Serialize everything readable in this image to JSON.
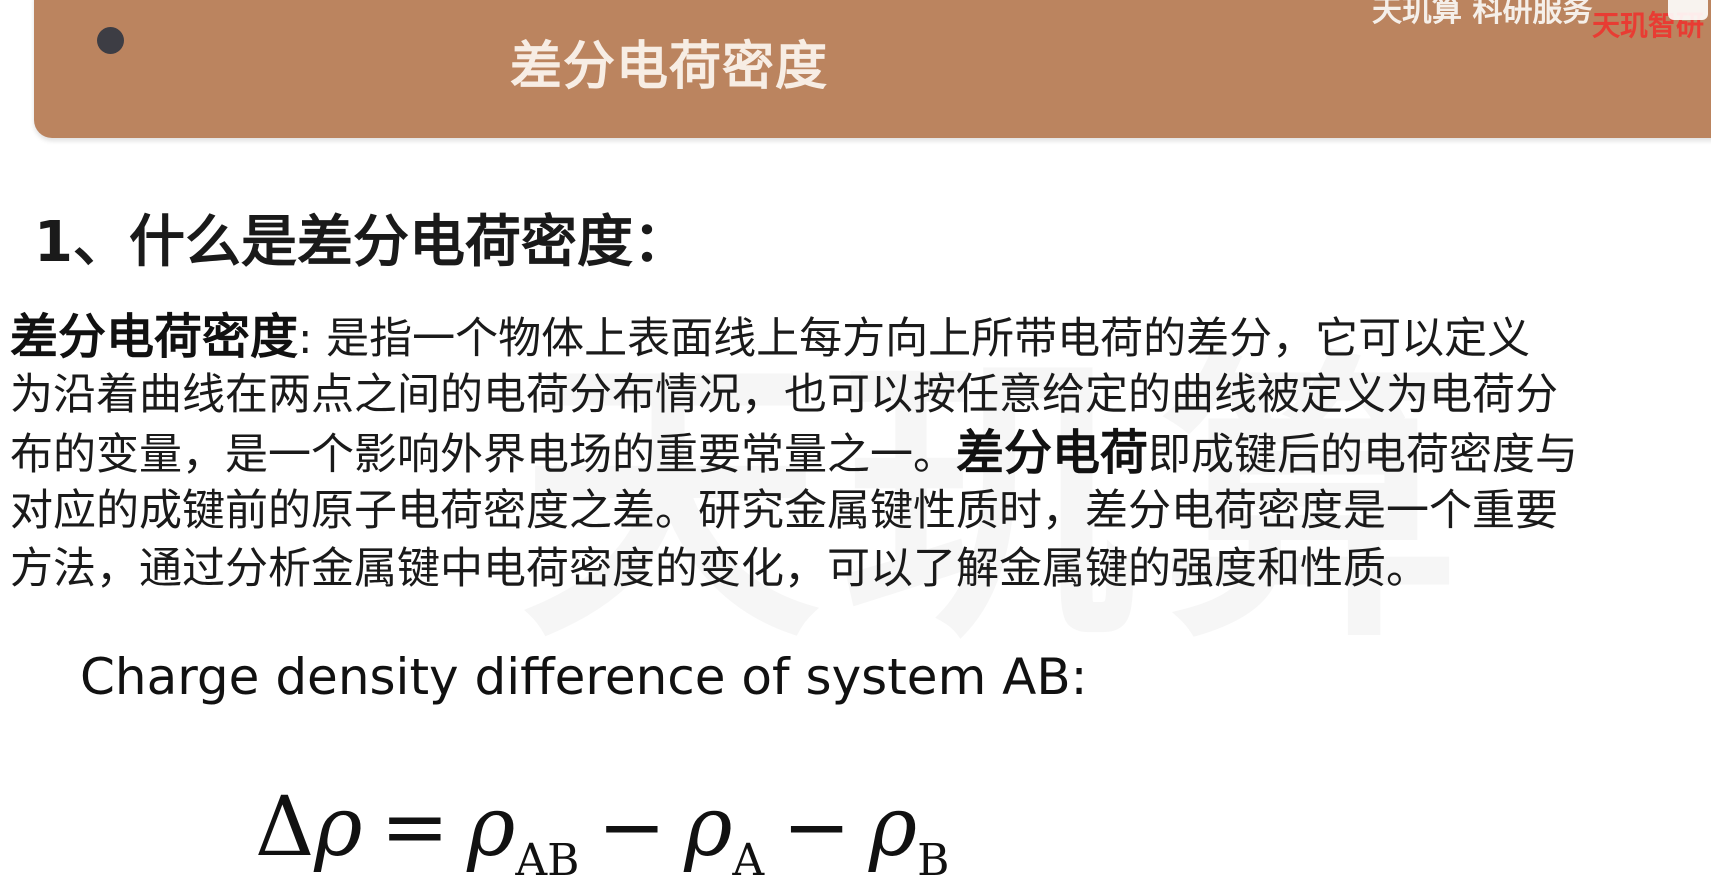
{
  "header": {
    "title": "差分电荷密度",
    "watermark_top": "天玑算 科研服务",
    "watermark_red": "天玑智研",
    "watermark_center": "天玑算"
  },
  "section": {
    "heading": "1、什么是差分电荷密度："
  },
  "paragraph": {
    "term1": "差分电荷密度",
    "line1_rest": ": 是指一个物体上表面线上每方向上所带电荷的差分，它可以定义",
    "line2": "为沿着曲线在两点之间的电荷分布情况，也可以按任意给定的曲线被定义为电荷分",
    "line3_start": "布的变量，是一个影响外界电场的重要常量之一。",
    "term2": "差分电荷",
    "line3_end": "即成键后的电荷密度与",
    "line4": "对应的成键前的原子电荷密度之差。研究金属键性质时，差分电荷密度是一个重要",
    "line5": "方法，通过分析金属键中电荷密度的变化，可以了解金属键的强度和性质。"
  },
  "subtitle": "Charge density difference of system AB:",
  "formula": {
    "delta": "Δ",
    "rho": "ρ",
    "equals": "=",
    "minus": "−",
    "sub_ab": "AB",
    "sub_a": "A",
    "sub_b": "B"
  }
}
